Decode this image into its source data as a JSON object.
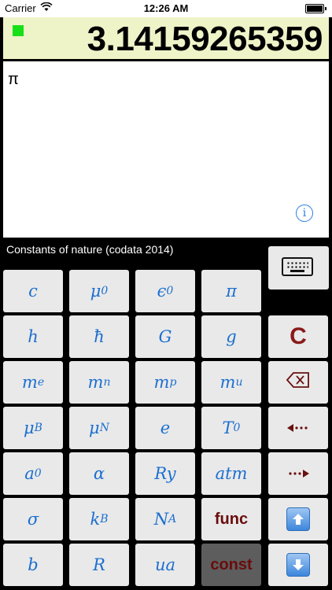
{
  "status": {
    "carrier": "Carrier",
    "time": "12:26 AM"
  },
  "display": {
    "value": "3.14159265359"
  },
  "expression": {
    "text": "π"
  },
  "mode": {
    "label": "Constants of nature (codata 2014)"
  },
  "colors": {
    "display_bg": "#eef4c8",
    "indicator": "#18e018",
    "key_text": "#1c6fd0",
    "func_text": "#6a0c0c"
  },
  "keys": {
    "c": "c",
    "mu0_main": "μ",
    "mu0_sub": "0",
    "eps0_main": "ϵ",
    "eps0_sub": "0",
    "pi": "π",
    "h": "h",
    "hbar": "ħ",
    "G": "G",
    "g": "g",
    "clear": "C",
    "me_main": "m",
    "me_sub": "e",
    "mn_main": "m",
    "mn_sub": "n",
    "mp_main": "m",
    "mp_sub": "p",
    "mu_main": "m",
    "mu_sub": "u",
    "muB_main": "μ",
    "muB_sub": "B",
    "muN_main": "μ",
    "muN_sub": "N",
    "e": "e",
    "T0_main": "T",
    "T0_sub": "0",
    "a0_main": "a",
    "a0_sub": "0",
    "alpha": "α",
    "Ry": "Ry",
    "atm": "atm",
    "sigma": "σ",
    "kB_main": "k",
    "kB_sub": "B",
    "NA_main": "N",
    "NA_sub": "A",
    "func": "func",
    "b": "b",
    "R": "R",
    "ua": "ua",
    "const": "const"
  },
  "icons": {
    "wifi": "wifi-icon",
    "battery": "battery-icon",
    "info": "info-icon",
    "keyboard": "keyboard-icon",
    "backspace": "backspace-icon",
    "cursor_left": "cursor-left-icon",
    "cursor_right": "cursor-right-icon",
    "up": "up-arrow-icon",
    "down": "down-arrow-icon"
  }
}
